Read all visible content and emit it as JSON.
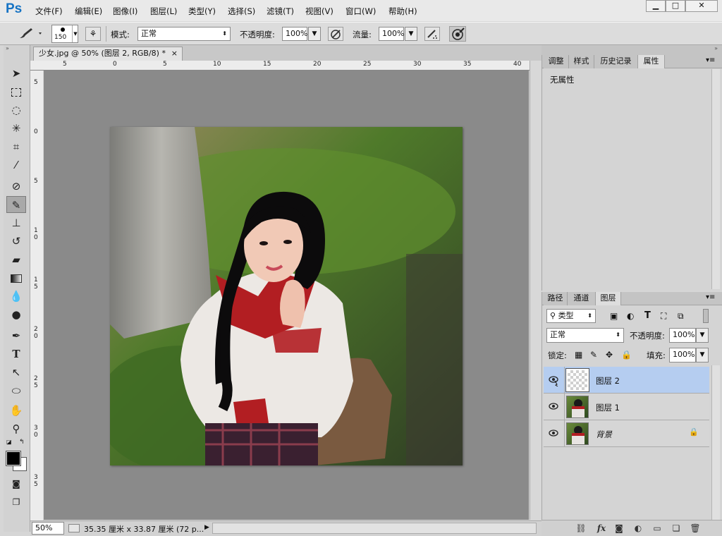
{
  "app": {
    "logo": "Ps"
  },
  "menu": [
    "文件(F)",
    "编辑(E)",
    "图像(I)",
    "图层(L)",
    "类型(Y)",
    "选择(S)",
    "滤镜(T)",
    "视图(V)",
    "窗口(W)",
    "帮助(H)"
  ],
  "window_controls": {
    "minimize": "▁",
    "maximize": "□",
    "close": "✕"
  },
  "options": {
    "brush_size": "150",
    "mode_label": "模式:",
    "mode_value": "正常",
    "opacity_label": "不透明度:",
    "opacity_value": "100%",
    "flow_label": "流量:",
    "flow_value": "100%"
  },
  "document": {
    "tab_title": "少女.jpg @ 50% (图层 2, RGB/8) *",
    "close": "×",
    "zoom": "50%",
    "doc_info": "35.35 厘米 x 33.87 厘米 (72 p..."
  },
  "ruler": {
    "top": [
      "5",
      "0",
      "5",
      "10",
      "15",
      "20",
      "25",
      "30",
      "35",
      "40"
    ],
    "left": [
      "5",
      "0",
      "5",
      "1 0",
      "1 5",
      "2 0",
      "2 5",
      "3 0",
      "3 5"
    ]
  },
  "properties_panel": {
    "tabs": [
      "调整",
      "样式",
      "历史记录",
      "属性"
    ],
    "active_tab": 3,
    "content": "无属性"
  },
  "layers_panel": {
    "tabs": [
      "路径",
      "通道",
      "图层"
    ],
    "active_tab": 2,
    "filter_kind": "类型",
    "blend_mode": "正常",
    "opacity_label": "不透明度:",
    "opacity_value": "100%",
    "lock_label": "锁定:",
    "fill_label": "填充:",
    "fill_value": "100%",
    "layers": [
      {
        "name": "图层 2",
        "selected": true,
        "thumb": "transparent"
      },
      {
        "name": "图层 1",
        "selected": false,
        "thumb": "photo"
      },
      {
        "name": "背景",
        "selected": false,
        "thumb": "photo",
        "locked": true
      }
    ]
  },
  "colors": {
    "accent": "#1673c4",
    "selection": "#b5cdf0"
  }
}
